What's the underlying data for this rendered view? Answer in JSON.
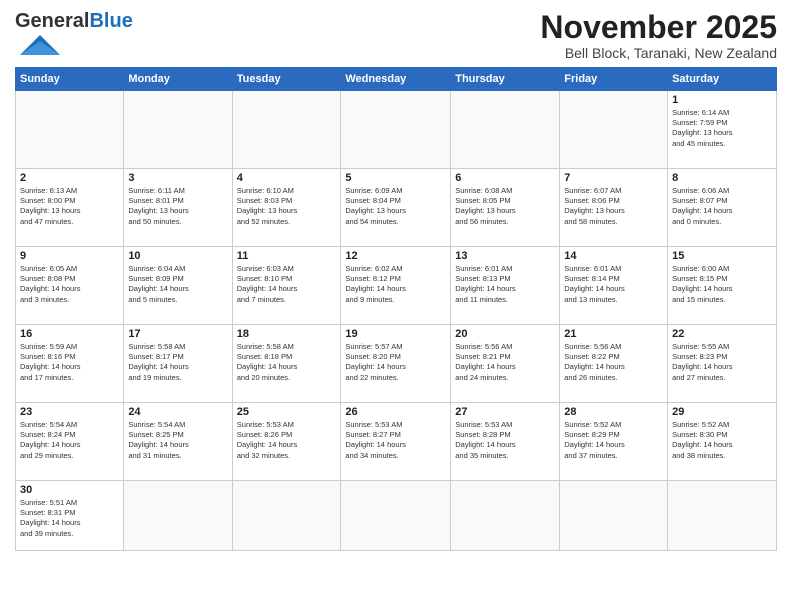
{
  "header": {
    "logo_general": "General",
    "logo_blue": "Blue",
    "month_title": "November 2025",
    "subtitle": "Bell Block, Taranaki, New Zealand"
  },
  "days_of_week": [
    "Sunday",
    "Monday",
    "Tuesday",
    "Wednesday",
    "Thursday",
    "Friday",
    "Saturday"
  ],
  "weeks": [
    [
      {
        "day": "",
        "info": ""
      },
      {
        "day": "",
        "info": ""
      },
      {
        "day": "",
        "info": ""
      },
      {
        "day": "",
        "info": ""
      },
      {
        "day": "",
        "info": ""
      },
      {
        "day": "",
        "info": ""
      },
      {
        "day": "1",
        "info": "Sunrise: 6:14 AM\nSunset: 7:59 PM\nDaylight: 13 hours\nand 45 minutes."
      }
    ],
    [
      {
        "day": "2",
        "info": "Sunrise: 6:13 AM\nSunset: 8:00 PM\nDaylight: 13 hours\nand 47 minutes."
      },
      {
        "day": "3",
        "info": "Sunrise: 6:11 AM\nSunset: 8:01 PM\nDaylight: 13 hours\nand 50 minutes."
      },
      {
        "day": "4",
        "info": "Sunrise: 6:10 AM\nSunset: 8:03 PM\nDaylight: 13 hours\nand 52 minutes."
      },
      {
        "day": "5",
        "info": "Sunrise: 6:09 AM\nSunset: 8:04 PM\nDaylight: 13 hours\nand 54 minutes."
      },
      {
        "day": "6",
        "info": "Sunrise: 6:08 AM\nSunset: 8:05 PM\nDaylight: 13 hours\nand 56 minutes."
      },
      {
        "day": "7",
        "info": "Sunrise: 6:07 AM\nSunset: 8:06 PM\nDaylight: 13 hours\nand 58 minutes."
      },
      {
        "day": "8",
        "info": "Sunrise: 6:06 AM\nSunset: 8:07 PM\nDaylight: 14 hours\nand 0 minutes."
      }
    ],
    [
      {
        "day": "9",
        "info": "Sunrise: 6:05 AM\nSunset: 8:08 PM\nDaylight: 14 hours\nand 3 minutes."
      },
      {
        "day": "10",
        "info": "Sunrise: 6:04 AM\nSunset: 8:09 PM\nDaylight: 14 hours\nand 5 minutes."
      },
      {
        "day": "11",
        "info": "Sunrise: 6:03 AM\nSunset: 8:10 PM\nDaylight: 14 hours\nand 7 minutes."
      },
      {
        "day": "12",
        "info": "Sunrise: 6:02 AM\nSunset: 8:12 PM\nDaylight: 14 hours\nand 9 minutes."
      },
      {
        "day": "13",
        "info": "Sunrise: 6:01 AM\nSunset: 8:13 PM\nDaylight: 14 hours\nand 11 minutes."
      },
      {
        "day": "14",
        "info": "Sunrise: 6:01 AM\nSunset: 8:14 PM\nDaylight: 14 hours\nand 13 minutes."
      },
      {
        "day": "15",
        "info": "Sunrise: 6:00 AM\nSunset: 8:15 PM\nDaylight: 14 hours\nand 15 minutes."
      }
    ],
    [
      {
        "day": "16",
        "info": "Sunrise: 5:59 AM\nSunset: 8:16 PM\nDaylight: 14 hours\nand 17 minutes."
      },
      {
        "day": "17",
        "info": "Sunrise: 5:58 AM\nSunset: 8:17 PM\nDaylight: 14 hours\nand 19 minutes."
      },
      {
        "day": "18",
        "info": "Sunrise: 5:58 AM\nSunset: 8:18 PM\nDaylight: 14 hours\nand 20 minutes."
      },
      {
        "day": "19",
        "info": "Sunrise: 5:57 AM\nSunset: 8:20 PM\nDaylight: 14 hours\nand 22 minutes."
      },
      {
        "day": "20",
        "info": "Sunrise: 5:56 AM\nSunset: 8:21 PM\nDaylight: 14 hours\nand 24 minutes."
      },
      {
        "day": "21",
        "info": "Sunrise: 5:56 AM\nSunset: 8:22 PM\nDaylight: 14 hours\nand 26 minutes."
      },
      {
        "day": "22",
        "info": "Sunrise: 5:55 AM\nSunset: 8:23 PM\nDaylight: 14 hours\nand 27 minutes."
      }
    ],
    [
      {
        "day": "23",
        "info": "Sunrise: 5:54 AM\nSunset: 8:24 PM\nDaylight: 14 hours\nand 29 minutes."
      },
      {
        "day": "24",
        "info": "Sunrise: 5:54 AM\nSunset: 8:25 PM\nDaylight: 14 hours\nand 31 minutes."
      },
      {
        "day": "25",
        "info": "Sunrise: 5:53 AM\nSunset: 8:26 PM\nDaylight: 14 hours\nand 32 minutes."
      },
      {
        "day": "26",
        "info": "Sunrise: 5:53 AM\nSunset: 8:27 PM\nDaylight: 14 hours\nand 34 minutes."
      },
      {
        "day": "27",
        "info": "Sunrise: 5:53 AM\nSunset: 8:28 PM\nDaylight: 14 hours\nand 35 minutes."
      },
      {
        "day": "28",
        "info": "Sunrise: 5:52 AM\nSunset: 8:29 PM\nDaylight: 14 hours\nand 37 minutes."
      },
      {
        "day": "29",
        "info": "Sunrise: 5:52 AM\nSunset: 8:30 PM\nDaylight: 14 hours\nand 38 minutes."
      }
    ],
    [
      {
        "day": "30",
        "info": "Sunrise: 5:51 AM\nSunset: 8:31 PM\nDaylight: 14 hours\nand 39 minutes."
      },
      {
        "day": "",
        "info": ""
      },
      {
        "day": "",
        "info": ""
      },
      {
        "day": "",
        "info": ""
      },
      {
        "day": "",
        "info": ""
      },
      {
        "day": "",
        "info": ""
      },
      {
        "day": "",
        "info": ""
      }
    ]
  ]
}
